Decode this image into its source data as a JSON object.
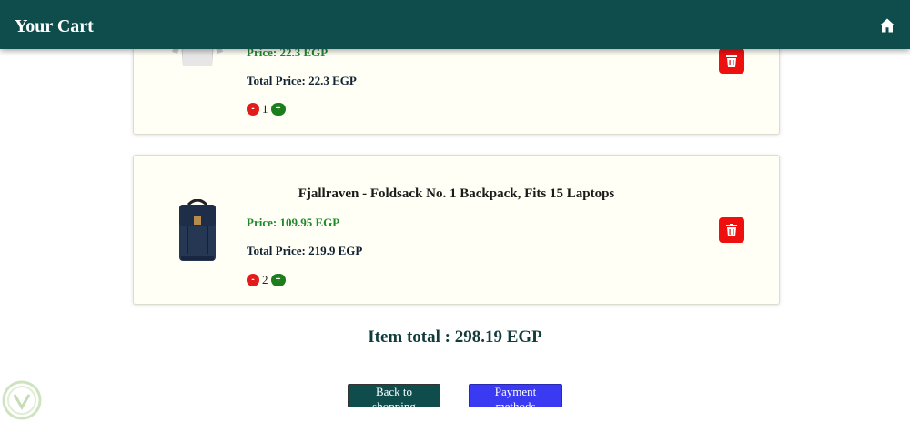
{
  "header": {
    "title": "Your Cart",
    "icon": "home-icon"
  },
  "cart_items": [
    {
      "name": "",
      "price_label": "Price: 22.3 EGP",
      "total_label": "Total Price: 22.3 EGP",
      "qty_minus": "-",
      "quantity": "1",
      "qty_plus": "+"
    },
    {
      "name": "Fjallraven - Foldsack No. 1 Backpack, Fits 15 Laptops",
      "price_label": "Price: 109.95 EGP",
      "total_label": "Total Price: 219.9 EGP",
      "qty_minus": "-",
      "quantity": "2",
      "qty_plus": "+"
    }
  ],
  "summary": {
    "item_total": "Item total : 298.19 EGP"
  },
  "actions": {
    "back_label": "Back to shopping",
    "payment_label": "Payment methods"
  },
  "colors": {
    "header_bg": "#0f4d4d",
    "card_bg": "#fffff5",
    "price_green": "#1d8a2a",
    "delete_red": "#ee0f0f",
    "payment_blue": "#3a3af2"
  }
}
